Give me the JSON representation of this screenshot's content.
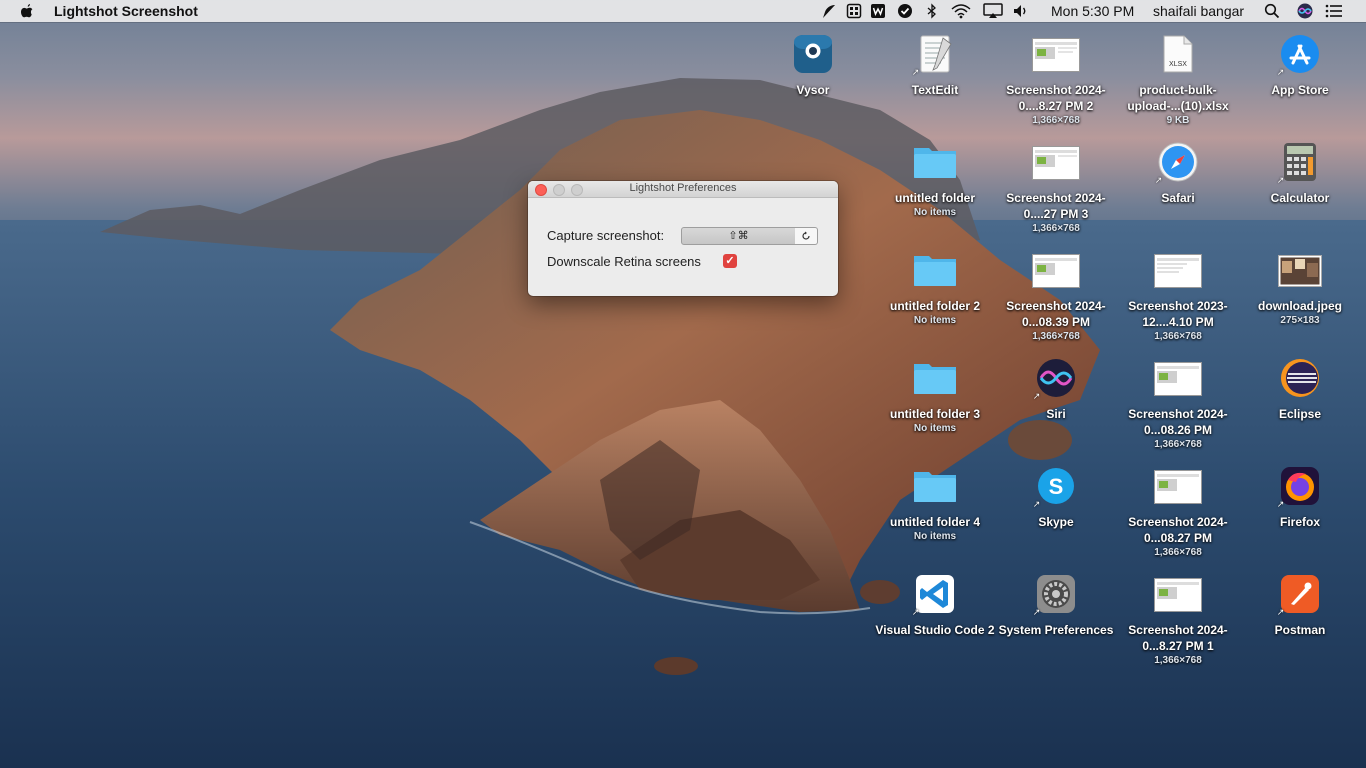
{
  "menubar": {
    "app_title": "Lightshot Screenshot",
    "clock": "Mon 5:30 PM",
    "user": "shaifali bangar",
    "status_icons": [
      "feather-icon",
      "grid-icon",
      "wps-icon",
      "check-icon",
      "bluetooth-icon",
      "wifi-icon",
      "airplay-icon",
      "volume-icon",
      "search-icon",
      "siri-icon",
      "list-icon"
    ]
  },
  "prefs": {
    "title": "Lightshot Preferences",
    "capture_label": "Capture screenshot:",
    "shortcut_value": "⇧⌘",
    "downscale_label": "Downscale Retina screens",
    "downscale_checked": true
  },
  "desktop": {
    "vysor": {
      "label": "Vysor"
    },
    "textedit": {
      "label": "TextEdit"
    },
    "shot_827_2": {
      "label": "Screenshot 2024-0....8.27 PM 2",
      "sub": "1,366×768"
    },
    "xlsx": {
      "label": "product-bulk-upload-...(10).xlsx",
      "sub": "9 KB",
      "badge": "XLSX"
    },
    "appstore": {
      "label": "App Store"
    },
    "folder1": {
      "label": "untitled folder",
      "sub": "No items"
    },
    "shot_827_3": {
      "label": "Screenshot 2024-0....27 PM 3",
      "sub": "1,366×768"
    },
    "safari": {
      "label": "Safari"
    },
    "calculator": {
      "label": "Calculator"
    },
    "folder2": {
      "label": "untitled folder 2",
      "sub": "No items"
    },
    "shot_839": {
      "label": "Screenshot 2024-0...08.39 PM",
      "sub": "1,366×768"
    },
    "shot_2023": {
      "label": "Screenshot 2023-12....4.10 PM",
      "sub": "1,366×768"
    },
    "download": {
      "label": "download.jpeg",
      "sub": "275×183"
    },
    "folder3": {
      "label": "untitled folder 3",
      "sub": "No items"
    },
    "siri": {
      "label": "Siri"
    },
    "shot_826": {
      "label": "Screenshot 2024-0...08.26 PM",
      "sub": "1,366×768"
    },
    "eclipse": {
      "label": "Eclipse"
    },
    "folder4": {
      "label": "untitled folder 4",
      "sub": "No items"
    },
    "skype": {
      "label": "Skype"
    },
    "shot_827": {
      "label": "Screenshot 2024-0...08.27 PM",
      "sub": "1,366×768"
    },
    "firefox": {
      "label": "Firefox"
    },
    "vscode": {
      "label": "Visual Studio Code 2"
    },
    "sysprefs": {
      "label": "System Preferences"
    },
    "shot_827_1": {
      "label": "Screenshot 2024-0...8.27 PM 1",
      "sub": "1,366×768"
    },
    "postman": {
      "label": "Postman"
    }
  },
  "colors": {
    "close": "#fc5f57",
    "checkbox": "#e0433f",
    "folder": "#5ec5f5"
  }
}
